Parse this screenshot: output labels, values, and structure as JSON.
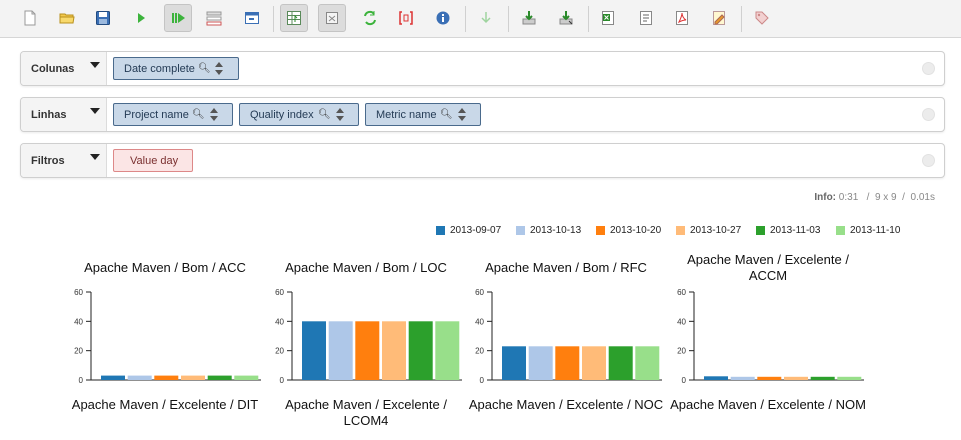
{
  "toolbar": {
    "buttons": [
      {
        "icon": "new-document-icon"
      },
      {
        "icon": "open-folder-icon"
      },
      {
        "icon": "save-disk-icon"
      },
      {
        "icon": "run-icon"
      },
      {
        "icon": "auto-run-icon"
      },
      {
        "icon": "hide-parents-icon"
      },
      {
        "icon": "toggle-layout-icon"
      },
      {
        "icon": "table-view-icon"
      },
      {
        "icon": "field-list-icon"
      },
      {
        "icon": "swap-axes-icon"
      },
      {
        "icon": "non-empty-icon"
      },
      {
        "icon": "info-icon"
      },
      {
        "icon": "drillthrough-icon"
      },
      {
        "icon": "export-down-icon"
      },
      {
        "icon": "export-down-alt-icon"
      },
      {
        "icon": "excel-export-icon"
      },
      {
        "icon": "csv-export-icon"
      },
      {
        "icon": "pdf-export-icon"
      },
      {
        "icon": "edit-export-icon"
      },
      {
        "icon": "tag-icon"
      }
    ]
  },
  "axes": {
    "columns": {
      "label": "Colunas",
      "chips": [
        "Date complete"
      ]
    },
    "rows": {
      "label": "Linhas",
      "chips": [
        "Project name",
        "Quality index",
        "Metric name"
      ]
    },
    "filters": {
      "label": "Filtros",
      "chips": [
        "Value day"
      ]
    }
  },
  "info": {
    "label": "Info:",
    "time": "0:31",
    "size": "9 x 9",
    "duration": "0.01s"
  },
  "legend": {
    "series": [
      {
        "name": "2013-09-07",
        "color": "#1f77b4"
      },
      {
        "name": "2013-10-13",
        "color": "#aec7e8"
      },
      {
        "name": "2013-10-20",
        "color": "#ff7f0e"
      },
      {
        "name": "2013-10-27",
        "color": "#ffbb78"
      },
      {
        "name": "2013-11-03",
        "color": "#2ca02c"
      },
      {
        "name": "2013-11-10",
        "color": "#98df8a"
      }
    ]
  },
  "chart_data": [
    {
      "type": "bar",
      "title": "Apache Maven / Bom / ACC",
      "categories": [
        "2013-09-07",
        "2013-10-13",
        "2013-10-20",
        "2013-10-27",
        "2013-11-03",
        "2013-11-10"
      ],
      "values": [
        3,
        3,
        3,
        3,
        3,
        3
      ],
      "ylim": [
        0,
        60
      ],
      "yticks": [
        "0",
        "20",
        "40",
        "60"
      ]
    },
    {
      "type": "bar",
      "title": "Apache Maven / Bom / LOC",
      "categories": [
        "2013-09-07",
        "2013-10-13",
        "2013-10-20",
        "2013-10-27",
        "2013-11-03",
        "2013-11-10"
      ],
      "values": [
        40,
        40,
        40,
        40,
        40,
        40
      ],
      "ylim": [
        0,
        60
      ],
      "yticks": [
        "0",
        "20",
        "40",
        "60"
      ]
    },
    {
      "type": "bar",
      "title": "Apache Maven / Bom / RFC",
      "categories": [
        "2013-09-07",
        "2013-10-13",
        "2013-10-20",
        "2013-10-27",
        "2013-11-03",
        "2013-11-10"
      ],
      "values": [
        23,
        23,
        23,
        23,
        23,
        23
      ],
      "ylim": [
        0,
        60
      ],
      "yticks": [
        "0",
        "20",
        "40",
        "60"
      ]
    },
    {
      "type": "bar",
      "title": "Apache Maven / Excelente / ACCM",
      "categories": [
        "2013-09-07",
        "2013-10-13",
        "2013-10-20",
        "2013-10-27",
        "2013-11-03",
        "2013-11-10"
      ],
      "values": [
        2.5,
        2.2,
        2.2,
        2.2,
        2.2,
        2.2
      ],
      "ylim": [
        0,
        60
      ],
      "yticks": [
        "0",
        "20",
        "40",
        "60"
      ]
    },
    {
      "type": "bar",
      "title": "Apache Maven / Excelente / DIT"
    },
    {
      "type": "bar",
      "title": "Apache Maven / Excelente / LCOM4"
    },
    {
      "type": "bar",
      "title": "Apache Maven / Excelente / NOC"
    },
    {
      "type": "bar",
      "title": "Apache Maven / Excelente / NOM"
    }
  ]
}
